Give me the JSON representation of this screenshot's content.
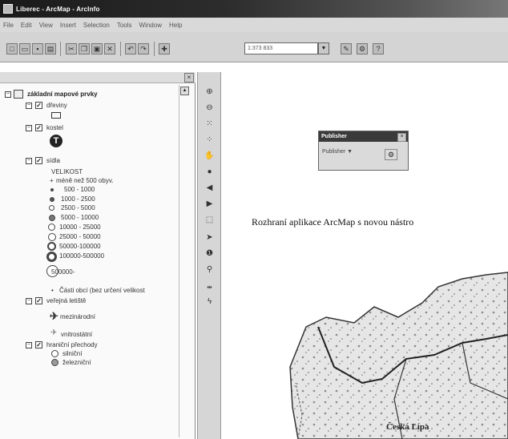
{
  "window": {
    "title": "Liberec - ArcMap - ArcInfo"
  },
  "menu": [
    "File",
    "Edit",
    "View",
    "Insert",
    "Selection",
    "Tools",
    "Window",
    "Help"
  ],
  "toolbar": {
    "scale_value": "1:373 833"
  },
  "toc": {
    "root_label": "základní mapové prvky",
    "layers": [
      {
        "name": "dřeviny"
      },
      {
        "name": "kostel"
      },
      {
        "name": "sídla",
        "field": "VELIKOST",
        "classes": [
          "méně než 500 obyv.",
          "500 - 1000",
          "1000 - 2500",
          "2500 - 5000",
          "5000 - 10000",
          "10000 - 25000",
          "25000 - 50000",
          "50000-100000",
          "100000-500000",
          "500000-",
          "Části obcí (bez určení velikost"
        ]
      },
      {
        "name": "veřejná letiště",
        "classes": [
          "mezinárodní",
          "vnitrostátní"
        ]
      },
      {
        "name": "hraniční přechody",
        "classes": [
          "silniční",
          "železniční"
        ]
      }
    ]
  },
  "floating_toolbar": {
    "title": "Publisher",
    "dropdown": "Publisher ▼"
  },
  "map": {
    "caption": "Rozhraní aplikace ArcMap s novou nástro",
    "city_label": "Česká Lípa"
  }
}
